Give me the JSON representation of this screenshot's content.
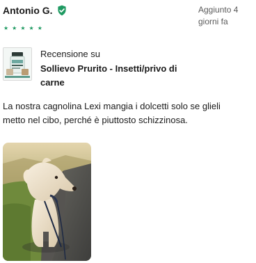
{
  "review": {
    "reviewer_name": "Antonio G.",
    "date_label": "Aggiunto 4 giorni fa",
    "rating": 5,
    "reviewed_label": "Recensione su",
    "product_name": "Sollievo Prurito - Insetti/privo di carne",
    "text": "La nostra cagnolina Lexi mangia i dolcetti solo se glieli metto nel cibo, perché è piuttosto schizzinosa.",
    "photo_icon": "customer-photo-dog"
  },
  "colors": {
    "verified_badge": "#1f9a62",
    "stars": "#1f9a62",
    "text": "#1a1a1a",
    "muted": "#5a5a5a"
  },
  "icons": {
    "verified": "check-shield-icon",
    "star": "star-icon"
  }
}
